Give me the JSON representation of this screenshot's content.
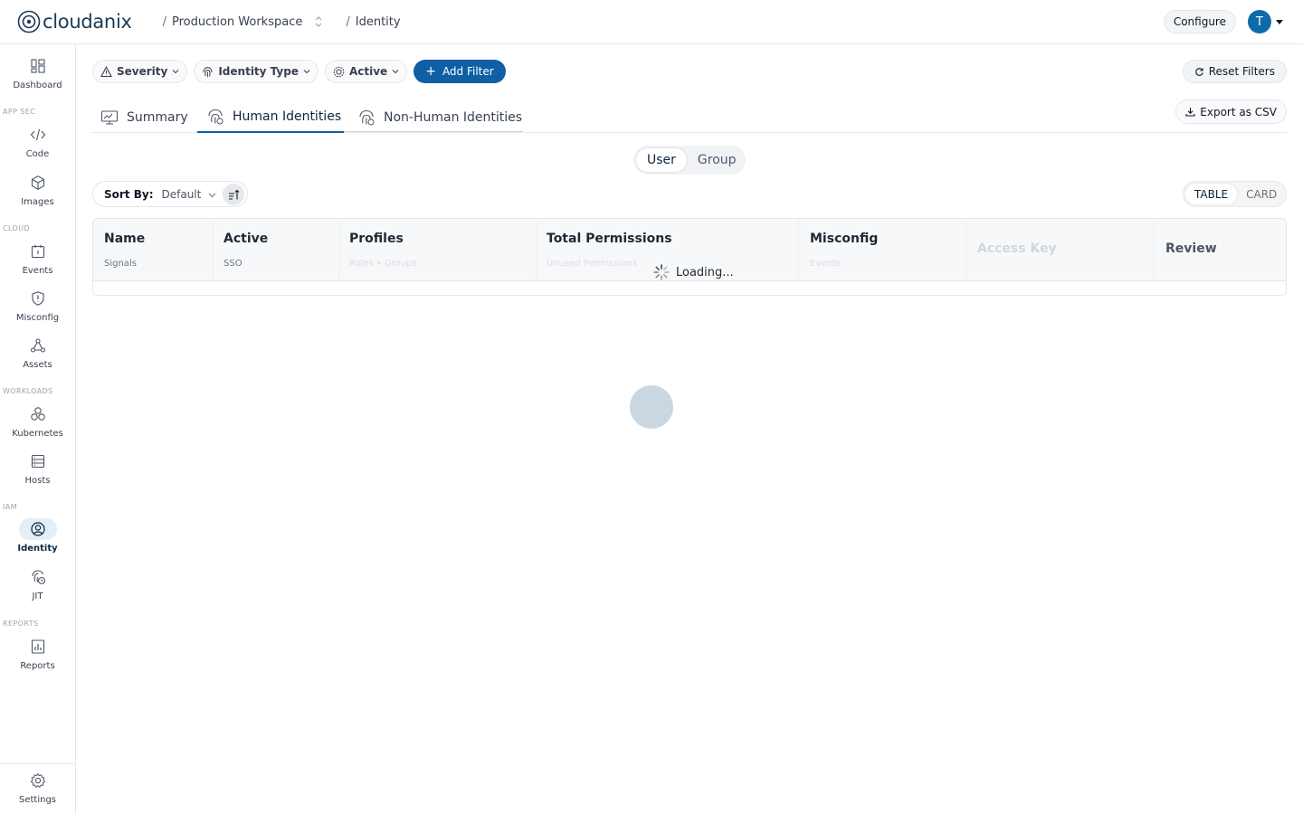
{
  "header": {
    "logo_text": "cloudanix",
    "workspace": "Production Workspace",
    "page": "Identity",
    "configure_label": "Configure",
    "avatar_initial": "T"
  },
  "sidebar": {
    "dashboard": "Dashboard",
    "section_appsec": "APP SEC",
    "code": "Code",
    "images": "Images",
    "section_cloud": "CLOUD",
    "events": "Events",
    "misconfig": "Misconfig",
    "assets": "Assets",
    "section_workloads": "WORKLOADS",
    "kubernetes": "Kubernetes",
    "hosts": "Hosts",
    "section_iam": "IAM",
    "identity": "Identity",
    "jit": "JIT",
    "section_reports": "REPORTS",
    "reports": "Reports",
    "settings": "Settings"
  },
  "filters": {
    "severity": "Severity",
    "identity_type": "Identity Type",
    "active": "Active",
    "add_filter": "Add Filter",
    "reset": "Reset Filters",
    "export": "Export as CSV"
  },
  "tabs": {
    "summary": "Summary",
    "human": "Human Identities",
    "non_human": "Non-Human Identities"
  },
  "segment": {
    "user": "User",
    "group": "Group"
  },
  "sort": {
    "label": "Sort By:",
    "value": "Default"
  },
  "view": {
    "table": "TABLE",
    "card": "CARD"
  },
  "table": {
    "columns": [
      {
        "title": "Name",
        "sub": "Signals"
      },
      {
        "title": "Active",
        "sub": "SSO"
      },
      {
        "title": "Profiles",
        "sub": "Roles • Groups"
      },
      {
        "title": "Total Permissions",
        "sub": "Unused Permissions"
      },
      {
        "title": "Misconfig",
        "sub": "Events"
      },
      {
        "title": "Access Key",
        "sub": ""
      },
      {
        "title": "Review",
        "sub": ""
      }
    ],
    "loading_text": "Loading..."
  },
  "colors": {
    "brand": "#0e5fa3",
    "active_nav_bg": "#e3eef7",
    "avatar": "#0e6ba8"
  }
}
